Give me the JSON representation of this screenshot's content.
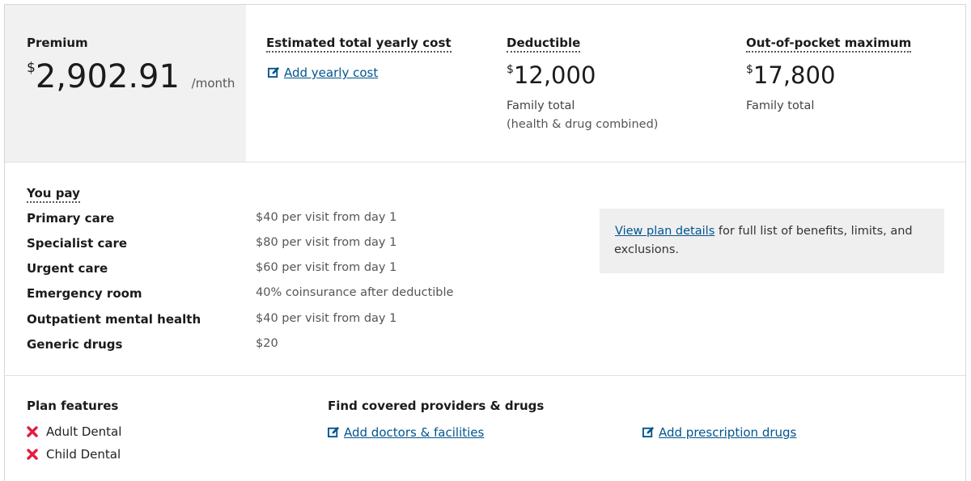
{
  "premium": {
    "label": "Premium",
    "currency": "$",
    "amount": "2,902.91",
    "period": "/month"
  },
  "yearly_cost": {
    "label": "Estimated total yearly cost",
    "link": "Add yearly cost"
  },
  "deductible": {
    "label": "Deductible",
    "currency": "$",
    "amount": "12,000",
    "sub1": "Family total",
    "sub2": "(health & drug combined)"
  },
  "oop": {
    "label": "Out-of-pocket maximum",
    "currency": "$",
    "amount": "17,800",
    "sub1": "Family total"
  },
  "you_pay": {
    "heading": "You pay",
    "rows": [
      {
        "label": "Primary care",
        "value": "$40 per visit from day 1"
      },
      {
        "label": "Specialist care",
        "value": "$80 per visit from day 1"
      },
      {
        "label": "Urgent care",
        "value": "$60 per visit from day 1"
      },
      {
        "label": "Emergency room",
        "value": "40% coinsurance after deductible"
      },
      {
        "label": "Outpatient mental health",
        "value": "$40 per visit from day 1"
      },
      {
        "label": "Generic drugs",
        "value": "$20"
      }
    ]
  },
  "plan_details": {
    "link": "View plan details",
    "text": " for full list of benefits, limits, and exclusions."
  },
  "plan_features": {
    "heading": "Plan features",
    "items": [
      {
        "label": "Adult Dental",
        "icon": "x-icon"
      },
      {
        "label": "Child Dental",
        "icon": "x-icon"
      }
    ]
  },
  "find": {
    "heading": "Find covered providers & drugs",
    "doctors_link": "Add doctors & facilities",
    "drugs_link": "Add prescription drugs"
  },
  "colors": {
    "link": "#00558d",
    "x_icon": "#e31c3d",
    "premium_bg": "#f1f1f1"
  }
}
